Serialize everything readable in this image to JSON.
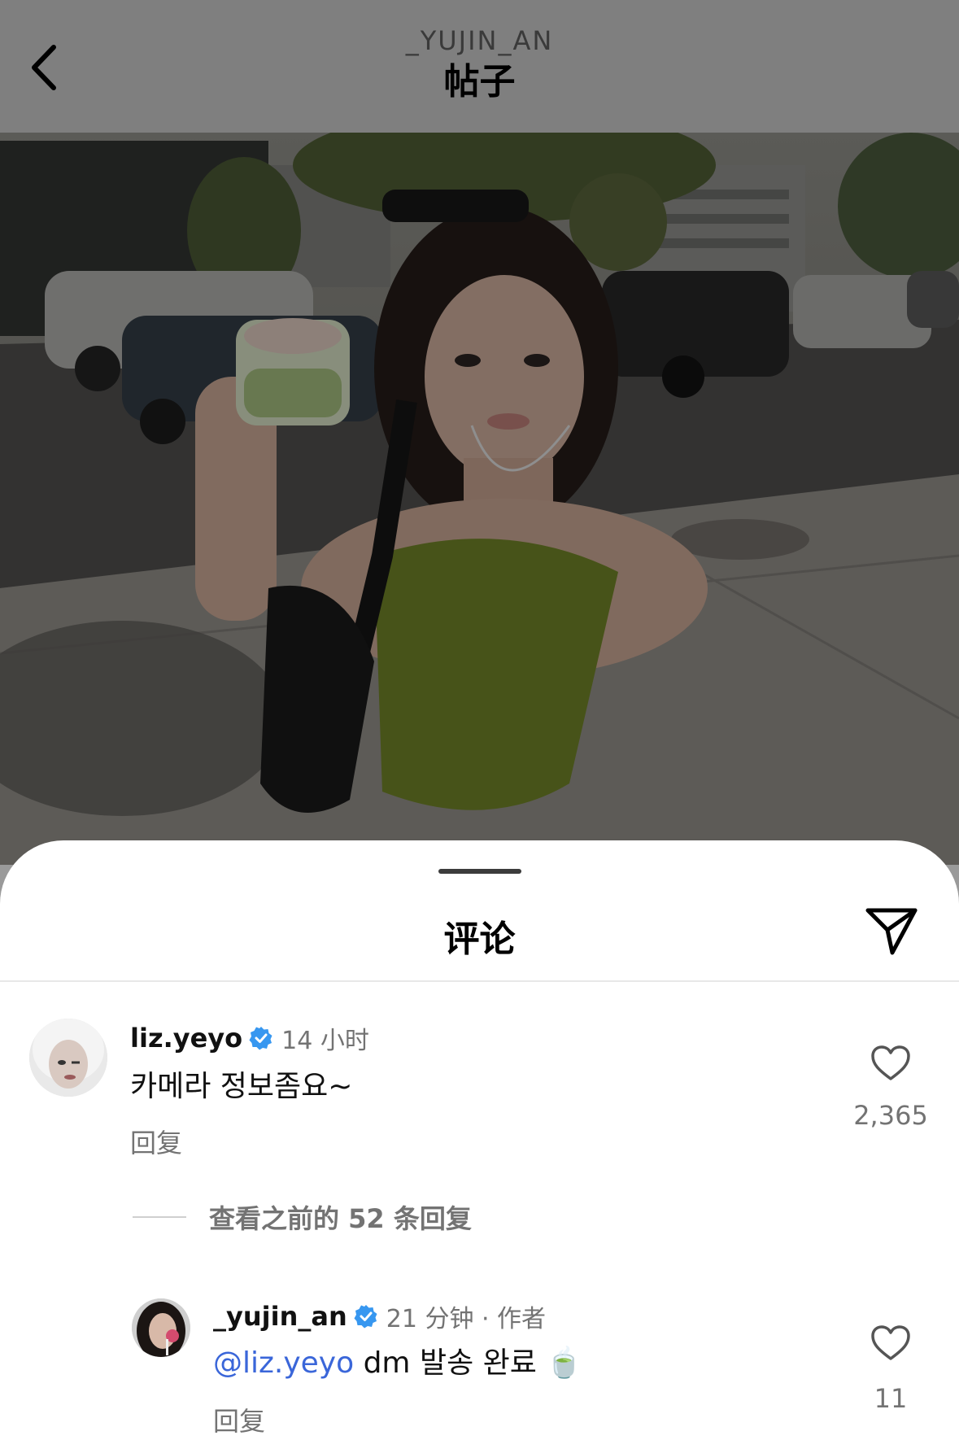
{
  "header": {
    "username": "_YUJIN_AN",
    "title": "帖子"
  },
  "sheet": {
    "title": "评论"
  },
  "comments": [
    {
      "username": "liz.yeyo",
      "verified": true,
      "time": "14 小时",
      "text": "카메라 정보좀요~",
      "reply_label": "回复",
      "likes": "2,365"
    }
  ],
  "view_replies": {
    "label": "查看之前的 52 条回复"
  },
  "replies": [
    {
      "username": "_yujin_an",
      "verified": true,
      "time": "21 分钟 · 作者",
      "mention": "@liz.yeyo",
      "text": " dm 발송 완료 ",
      "emoji": "🍵",
      "reply_label": "回复",
      "likes": "11"
    }
  ],
  "colors": {
    "verified_blue": "#3797f0",
    "mention_blue": "#3a66d9",
    "secondary_text": "#737373"
  }
}
